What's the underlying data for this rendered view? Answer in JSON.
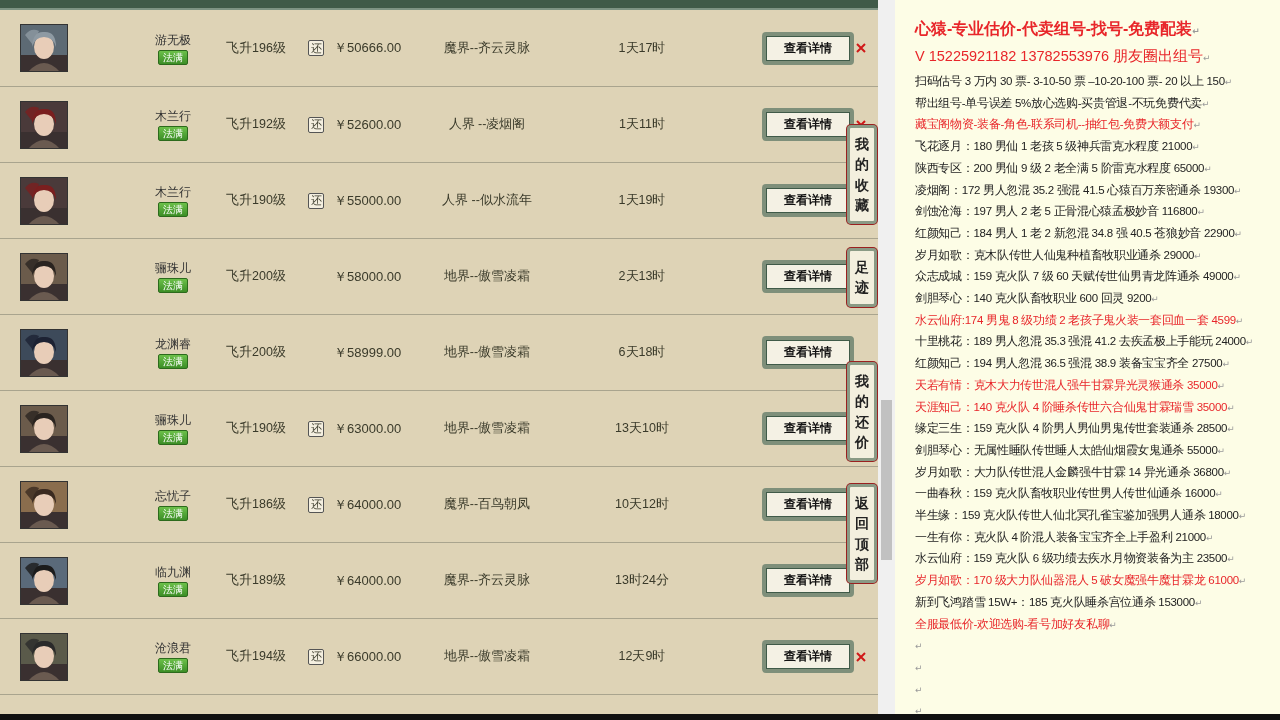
{
  "listings": [
    {
      "name": "游无极",
      "badge": "法满",
      "level": "飞升196级",
      "bargain": true,
      "bargain_label": "还",
      "price": "￥50666.00",
      "server": "魔界--齐云灵脉",
      "time_left": "1天17时",
      "button": "查看详情",
      "flagged": true
    },
    {
      "name": "木兰行",
      "badge": "法满",
      "level": "飞升192级",
      "bargain": true,
      "bargain_label": "还",
      "price": "￥52600.00",
      "server": "人界 --凌烟阁",
      "time_left": "1天11时",
      "button": "查看详情",
      "flagged": true
    },
    {
      "name": "木兰行",
      "badge": "法满",
      "level": "飞升190级",
      "bargain": true,
      "bargain_label": "还",
      "price": "￥55000.00",
      "server": "人界 --似水流年",
      "time_left": "1天19时",
      "button": "查看详情",
      "flagged": false
    },
    {
      "name": "骊珠儿",
      "badge": "法满",
      "level": "飞升200级",
      "bargain": false,
      "price": "￥58000.00",
      "server": "地界--傲雪凌霜",
      "time_left": "2天13时",
      "button": "查看详情",
      "flagged": false
    },
    {
      "name": "龙渊睿",
      "badge": "法满",
      "level": "飞升200级",
      "bargain": false,
      "price": "￥58999.00",
      "server": "地界--傲雪凌霜",
      "time_left": "6天18时",
      "button": "查看详情",
      "flagged": false
    },
    {
      "name": "骊珠儿",
      "badge": "法满",
      "level": "飞升190级",
      "bargain": true,
      "bargain_label": "还",
      "price": "￥63000.00",
      "server": "地界--傲雪凌霜",
      "time_left": "13天10时",
      "button": "查看详情",
      "flagged": false
    },
    {
      "name": "忘忧子",
      "badge": "法满",
      "level": "飞升186级",
      "bargain": true,
      "bargain_label": "还",
      "price": "￥64000.00",
      "server": "魔界--百鸟朝凤",
      "time_left": "10天12时",
      "button": "查看详情",
      "flagged": false
    },
    {
      "name": "临九渊",
      "badge": "法满",
      "level": "飞升189级",
      "bargain": false,
      "price": "￥64000.00",
      "server": "魔界--齐云灵脉",
      "time_left": "13时24分",
      "button": "查看详情",
      "flagged": false
    },
    {
      "name": "沧浪君",
      "badge": "法满",
      "level": "飞升194级",
      "bargain": true,
      "bargain_label": "还",
      "price": "￥66000.00",
      "server": "地界--傲雪凌霜",
      "time_left": "12天9时",
      "button": "查看详情",
      "flagged": true
    }
  ],
  "side_tabs": [
    "我的收藏",
    "足迹",
    "我的还价",
    "返回顶部"
  ],
  "notes": [
    {
      "kind": "heading",
      "text": "心猿-专业估价-代卖组号-找号-免费配装",
      "end_mark": "↵",
      "highlighted": true
    },
    {
      "kind": "heading",
      "text": "V 15225921182    13782553976 朋友圈出组号",
      "end_mark": "↵",
      "highlighted": true
    },
    {
      "kind": "line",
      "text": "扫码估号 3 万内 30 票- 3-10-50 票  –10-20-100 票- 20 以上 150",
      "end_mark": "↵",
      "highlighted": false
    },
    {
      "kind": "line",
      "text": "帮出组号-单号误差 5%放心选购-买贵管退-不玩免费代卖",
      "end_mark": "↵",
      "highlighted": false
    },
    {
      "kind": "line",
      "text": "藏宝阁物资-装备-角色-联系司机--抽红包-免费大额支付",
      "end_mark": "↵",
      "highlighted": true
    },
    {
      "kind": "line",
      "text": "飞花逐月：180 男仙 1 老孩 5 级神兵雷克水程度 21000",
      "end_mark": "↵",
      "highlighted": false
    },
    {
      "kind": "line",
      "text": "陕西专区：200 男仙 9 级 2 老全满 5 阶雷克水程度 65000",
      "end_mark": "↵",
      "highlighted": false
    },
    {
      "kind": "line",
      "text": "凌烟阁：172 男人忽混 35.2 强混 41.5 心猿百万亲密通杀 19300",
      "end_mark": "↵",
      "highlighted": false
    },
    {
      "kind": "line",
      "text": "剑蚀沧海：197 男人 2 老 5 正骨混心猿孟极妙音 116800",
      "end_mark": "↵",
      "highlighted": false
    },
    {
      "kind": "line",
      "text": "红颜知己：184 男人 1 老 2 新忽混 34.8 强 40.5 苍狼妙音 22900",
      "end_mark": "↵",
      "highlighted": false
    },
    {
      "kind": "line",
      "text": "岁月如歌：克木队传世人仙鬼种植畜牧职业通杀 29000",
      "end_mark": "↵",
      "highlighted": false
    },
    {
      "kind": "line",
      "text": "众志成城：159 克火队 7 级 60 天赋传世仙男青龙阵通杀 49000",
      "end_mark": "↵",
      "highlighted": false
    },
    {
      "kind": "line",
      "text": "剑胆琴心：140 克火队畜牧职业 600 回灵 9200",
      "end_mark": "↵",
      "highlighted": false
    },
    {
      "kind": "line",
      "text": "水云仙府:174 男鬼 8 级功绩 2 老孩子鬼火装一套回血一套 4599",
      "end_mark": "↵",
      "highlighted": true
    },
    {
      "kind": "line",
      "text": "十里桃花：189 男人忽混 35.3 强混 41.2 去疾孟极上手能玩 24000",
      "end_mark": "↵",
      "highlighted": false
    },
    {
      "kind": "line",
      "text": "红颜知己：194 男人忽混 36.5 强混 38.9 装备宝宝齐全 27500",
      "end_mark": "↵",
      "highlighted": false
    },
    {
      "kind": "line",
      "text": "天若有情：克木大力传世混人强牛甘霖异光灵猴通杀 35000",
      "end_mark": "↵",
      "highlighted": true
    },
    {
      "kind": "line",
      "text": "天涯知己：140 克火队 4 阶睡杀传世六合仙鬼甘霖瑞雪 35000",
      "end_mark": "↵",
      "highlighted": true
    },
    {
      "kind": "line",
      "text": "缘定三生：159 克火队 4 阶男人男仙男鬼传世套装通杀 28500",
      "end_mark": "↵",
      "highlighted": false
    },
    {
      "kind": "line",
      "text": "剑胆琴心：无属性睡队传世睡人太皓仙烟霞女鬼通杀 55000",
      "end_mark": "↵",
      "highlighted": false
    },
    {
      "kind": "line",
      "text": "岁月如歌：大力队传世混人金麟强牛甘霖 14 异光通杀 36800",
      "end_mark": "↵",
      "highlighted": false
    },
    {
      "kind": "line",
      "text": "一曲春秋：159 克火队畜牧职业传世男人传世仙通杀 16000",
      "end_mark": "↵",
      "highlighted": false
    },
    {
      "kind": "line",
      "text": "半生缘：159 克火队传世人仙北冥孔雀宝鉴加强男人通杀 18000",
      "end_mark": "↵",
      "highlighted": false
    },
    {
      "kind": "line",
      "text": "一生有你：克火队 4 阶混人装备宝宝齐全上手盈利 21000",
      "end_mark": "↵",
      "highlighted": false
    },
    {
      "kind": "line",
      "text": "水云仙府：159 克火队 6 级功绩去疾水月物资装备为主 23500",
      "end_mark": "↵",
      "highlighted": false
    },
    {
      "kind": "line",
      "text": "岁月如歌：170 级大力队仙器混人 5 破女魔强牛魔甘霖龙 61000",
      "end_mark": "↵",
      "highlighted": true
    },
    {
      "kind": "line",
      "text": "新到飞鸿踏雪 15W+：185 克火队睡杀宫位通杀 153000",
      "end_mark": "↵",
      "highlighted": false
    },
    {
      "kind": "line",
      "text": "全服最低价-欢迎选购-看号加好友私聊",
      "end_mark": "↵",
      "highlighted": true
    },
    {
      "kind": "line",
      "end_mark": "↵",
      "highlighted": false
    },
    {
      "kind": "line",
      "end_mark": "↵",
      "highlighted": false
    },
    {
      "kind": "line",
      "end_mark": "↵",
      "highlighted": false
    },
    {
      "kind": "line",
      "end_mark": "↵",
      "highlighted": false
    }
  ]
}
